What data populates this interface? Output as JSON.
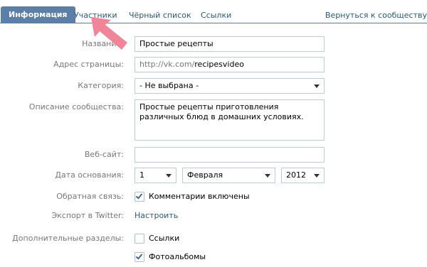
{
  "tabs": [
    {
      "label": "Информация",
      "active": true
    },
    {
      "label": "Участники"
    },
    {
      "label": "Чёрный список"
    },
    {
      "label": "Ссылки"
    }
  ],
  "back_link": "Вернуться к сообществу",
  "form": {
    "name_label": "Название:",
    "name_value": "Простые рецепты",
    "address_label": "Адрес страницы:",
    "address_prefix": "http://vk.com/",
    "address_value": "recipesvideo",
    "category_label": "Категория:",
    "category_value": "- Не выбрана -",
    "description_label": "Описание сообщества:",
    "description_value": "Простые рецепты приготовления различных блюд в домашних условиях.",
    "website_label": "Веб-сайт:",
    "website_value": "",
    "founded_label": "Дата основания:",
    "founded_day": "1",
    "founded_month": "Февраля",
    "founded_year": "2012",
    "feedback_label": "Обратная связь:",
    "feedback_option": "Комментарии включены",
    "feedback_checked": true,
    "twitter_label": "Экспорт в Twitter:",
    "twitter_link": "Настроить",
    "extra_label": "Дополнительные разделы:",
    "extra_links": "Ссылки",
    "extra_links_checked": false,
    "extra_albums": "Фотоальбомы",
    "extra_albums_checked": true
  },
  "colors": {
    "accent": "#5b7fa6",
    "link": "#2b587a",
    "label": "#777777",
    "annotation_arrow": "#f0859a"
  },
  "icons": {
    "annotation": "pink-arrow-icon",
    "dropdown": "dropdown-arrow-icon",
    "check": "checkmark-icon"
  }
}
